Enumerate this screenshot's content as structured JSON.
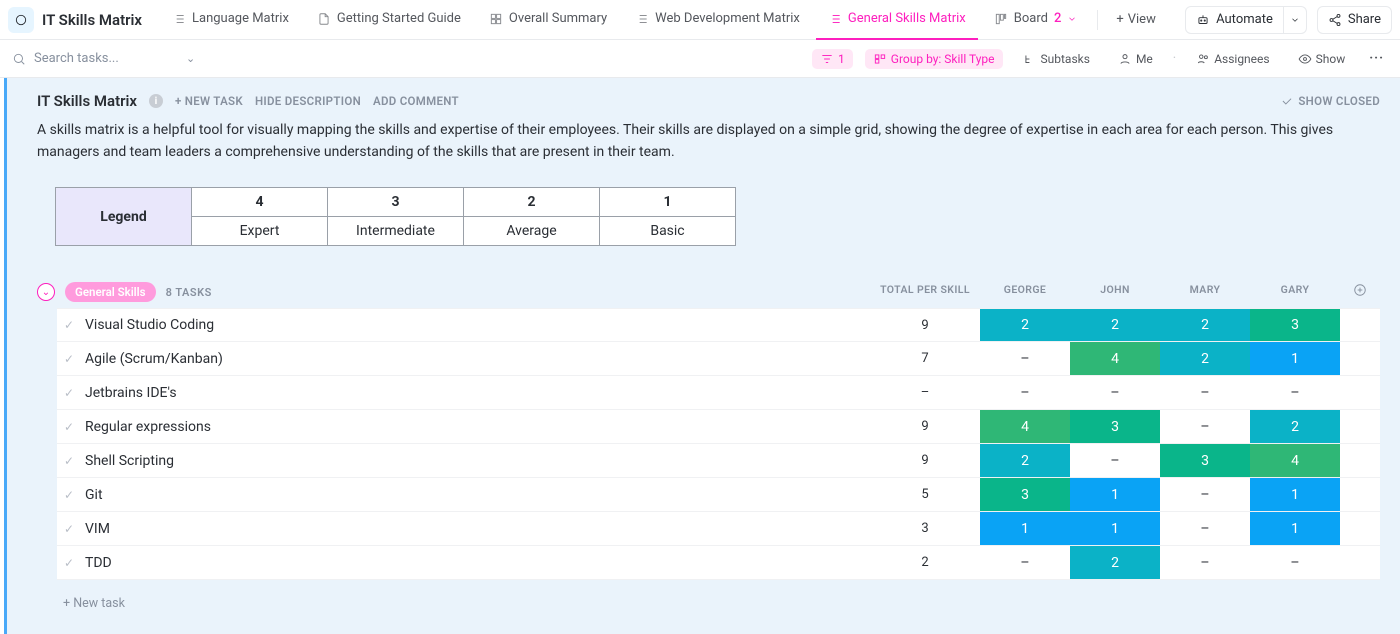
{
  "app_title": "IT Skills Matrix",
  "tabs": [
    {
      "label": "Language Matrix",
      "icon": "list"
    },
    {
      "label": "Getting Started Guide",
      "icon": "doc"
    },
    {
      "label": "Overall Summary",
      "icon": "grid"
    },
    {
      "label": "Web Development Matrix",
      "icon": "list"
    },
    {
      "label": "General Skills Matrix",
      "icon": "list",
      "active": true
    },
    {
      "label": "Board",
      "icon": "board",
      "count": "2"
    }
  ],
  "add_view": "View",
  "automate": "Automate",
  "share": "Share",
  "search_placeholder": "Search tasks...",
  "filters": {
    "filter_count": "1",
    "group_by": "Group by: Skill Type",
    "subtasks": "Subtasks",
    "me": "Me",
    "assignees": "Assignees",
    "show": "Show"
  },
  "page": {
    "title": "IT Skills Matrix",
    "new_task": "+ NEW TASK",
    "hide_desc": "HIDE DESCRIPTION",
    "add_comment": "ADD COMMENT",
    "show_closed": "SHOW CLOSED",
    "description": "A skills matrix is a helpful tool for visually mapping the skills and expertise of their employees. Their skills are displayed on a simple grid, showing the degree of expertise in each area for each person. This gives managers and team leaders a comprehensive understanding of the skills that are present in their team."
  },
  "legend": {
    "title": "Legend",
    "cols": [
      "4",
      "3",
      "2",
      "1"
    ],
    "labels": [
      "Expert",
      "Intermediate",
      "Average",
      "Basic"
    ]
  },
  "group": {
    "name": "General Skills",
    "count": "8 TASKS",
    "columns": [
      "TOTAL PER SKILL",
      "GEORGE",
      "JOHN",
      "MARY",
      "GARY"
    ],
    "rows": [
      {
        "name": "Visual Studio Coding",
        "total": "9",
        "cells": [
          {
            "v": "2",
            "c": "teal"
          },
          {
            "v": "2",
            "c": "teal"
          },
          {
            "v": "2",
            "c": "teal"
          },
          {
            "v": "3",
            "c": "emerald"
          }
        ]
      },
      {
        "name": "Agile (Scrum/Kanban)",
        "total": "7",
        "cells": [
          {
            "v": "–",
            "c": "none"
          },
          {
            "v": "4",
            "c": "green"
          },
          {
            "v": "2",
            "c": "teal"
          },
          {
            "v": "1",
            "c": "blue"
          }
        ]
      },
      {
        "name": "Jetbrains IDE's",
        "total": "–",
        "cells": [
          {
            "v": "–",
            "c": "none"
          },
          {
            "v": "–",
            "c": "none"
          },
          {
            "v": "–",
            "c": "none"
          },
          {
            "v": "–",
            "c": "none"
          }
        ]
      },
      {
        "name": "Regular expressions",
        "total": "9",
        "cells": [
          {
            "v": "4",
            "c": "green"
          },
          {
            "v": "3",
            "c": "emerald"
          },
          {
            "v": "–",
            "c": "none"
          },
          {
            "v": "2",
            "c": "teal"
          }
        ]
      },
      {
        "name": "Shell Scripting",
        "total": "9",
        "cells": [
          {
            "v": "2",
            "c": "teal"
          },
          {
            "v": "–",
            "c": "none"
          },
          {
            "v": "3",
            "c": "emerald"
          },
          {
            "v": "4",
            "c": "green"
          }
        ]
      },
      {
        "name": "Git",
        "total": "5",
        "cells": [
          {
            "v": "3",
            "c": "emerald"
          },
          {
            "v": "1",
            "c": "blue"
          },
          {
            "v": "–",
            "c": "none"
          },
          {
            "v": "1",
            "c": "blue"
          }
        ]
      },
      {
        "name": "VIM",
        "total": "3",
        "cells": [
          {
            "v": "1",
            "c": "blue"
          },
          {
            "v": "1",
            "c": "blue"
          },
          {
            "v": "–",
            "c": "none"
          },
          {
            "v": "1",
            "c": "blue"
          }
        ]
      },
      {
        "name": "TDD",
        "total": "2",
        "cells": [
          {
            "v": "–",
            "c": "none"
          },
          {
            "v": "2",
            "c": "teal"
          },
          {
            "v": "–",
            "c": "none"
          },
          {
            "v": "–",
            "c": "none"
          }
        ]
      }
    ],
    "new_task": "+ New task"
  }
}
